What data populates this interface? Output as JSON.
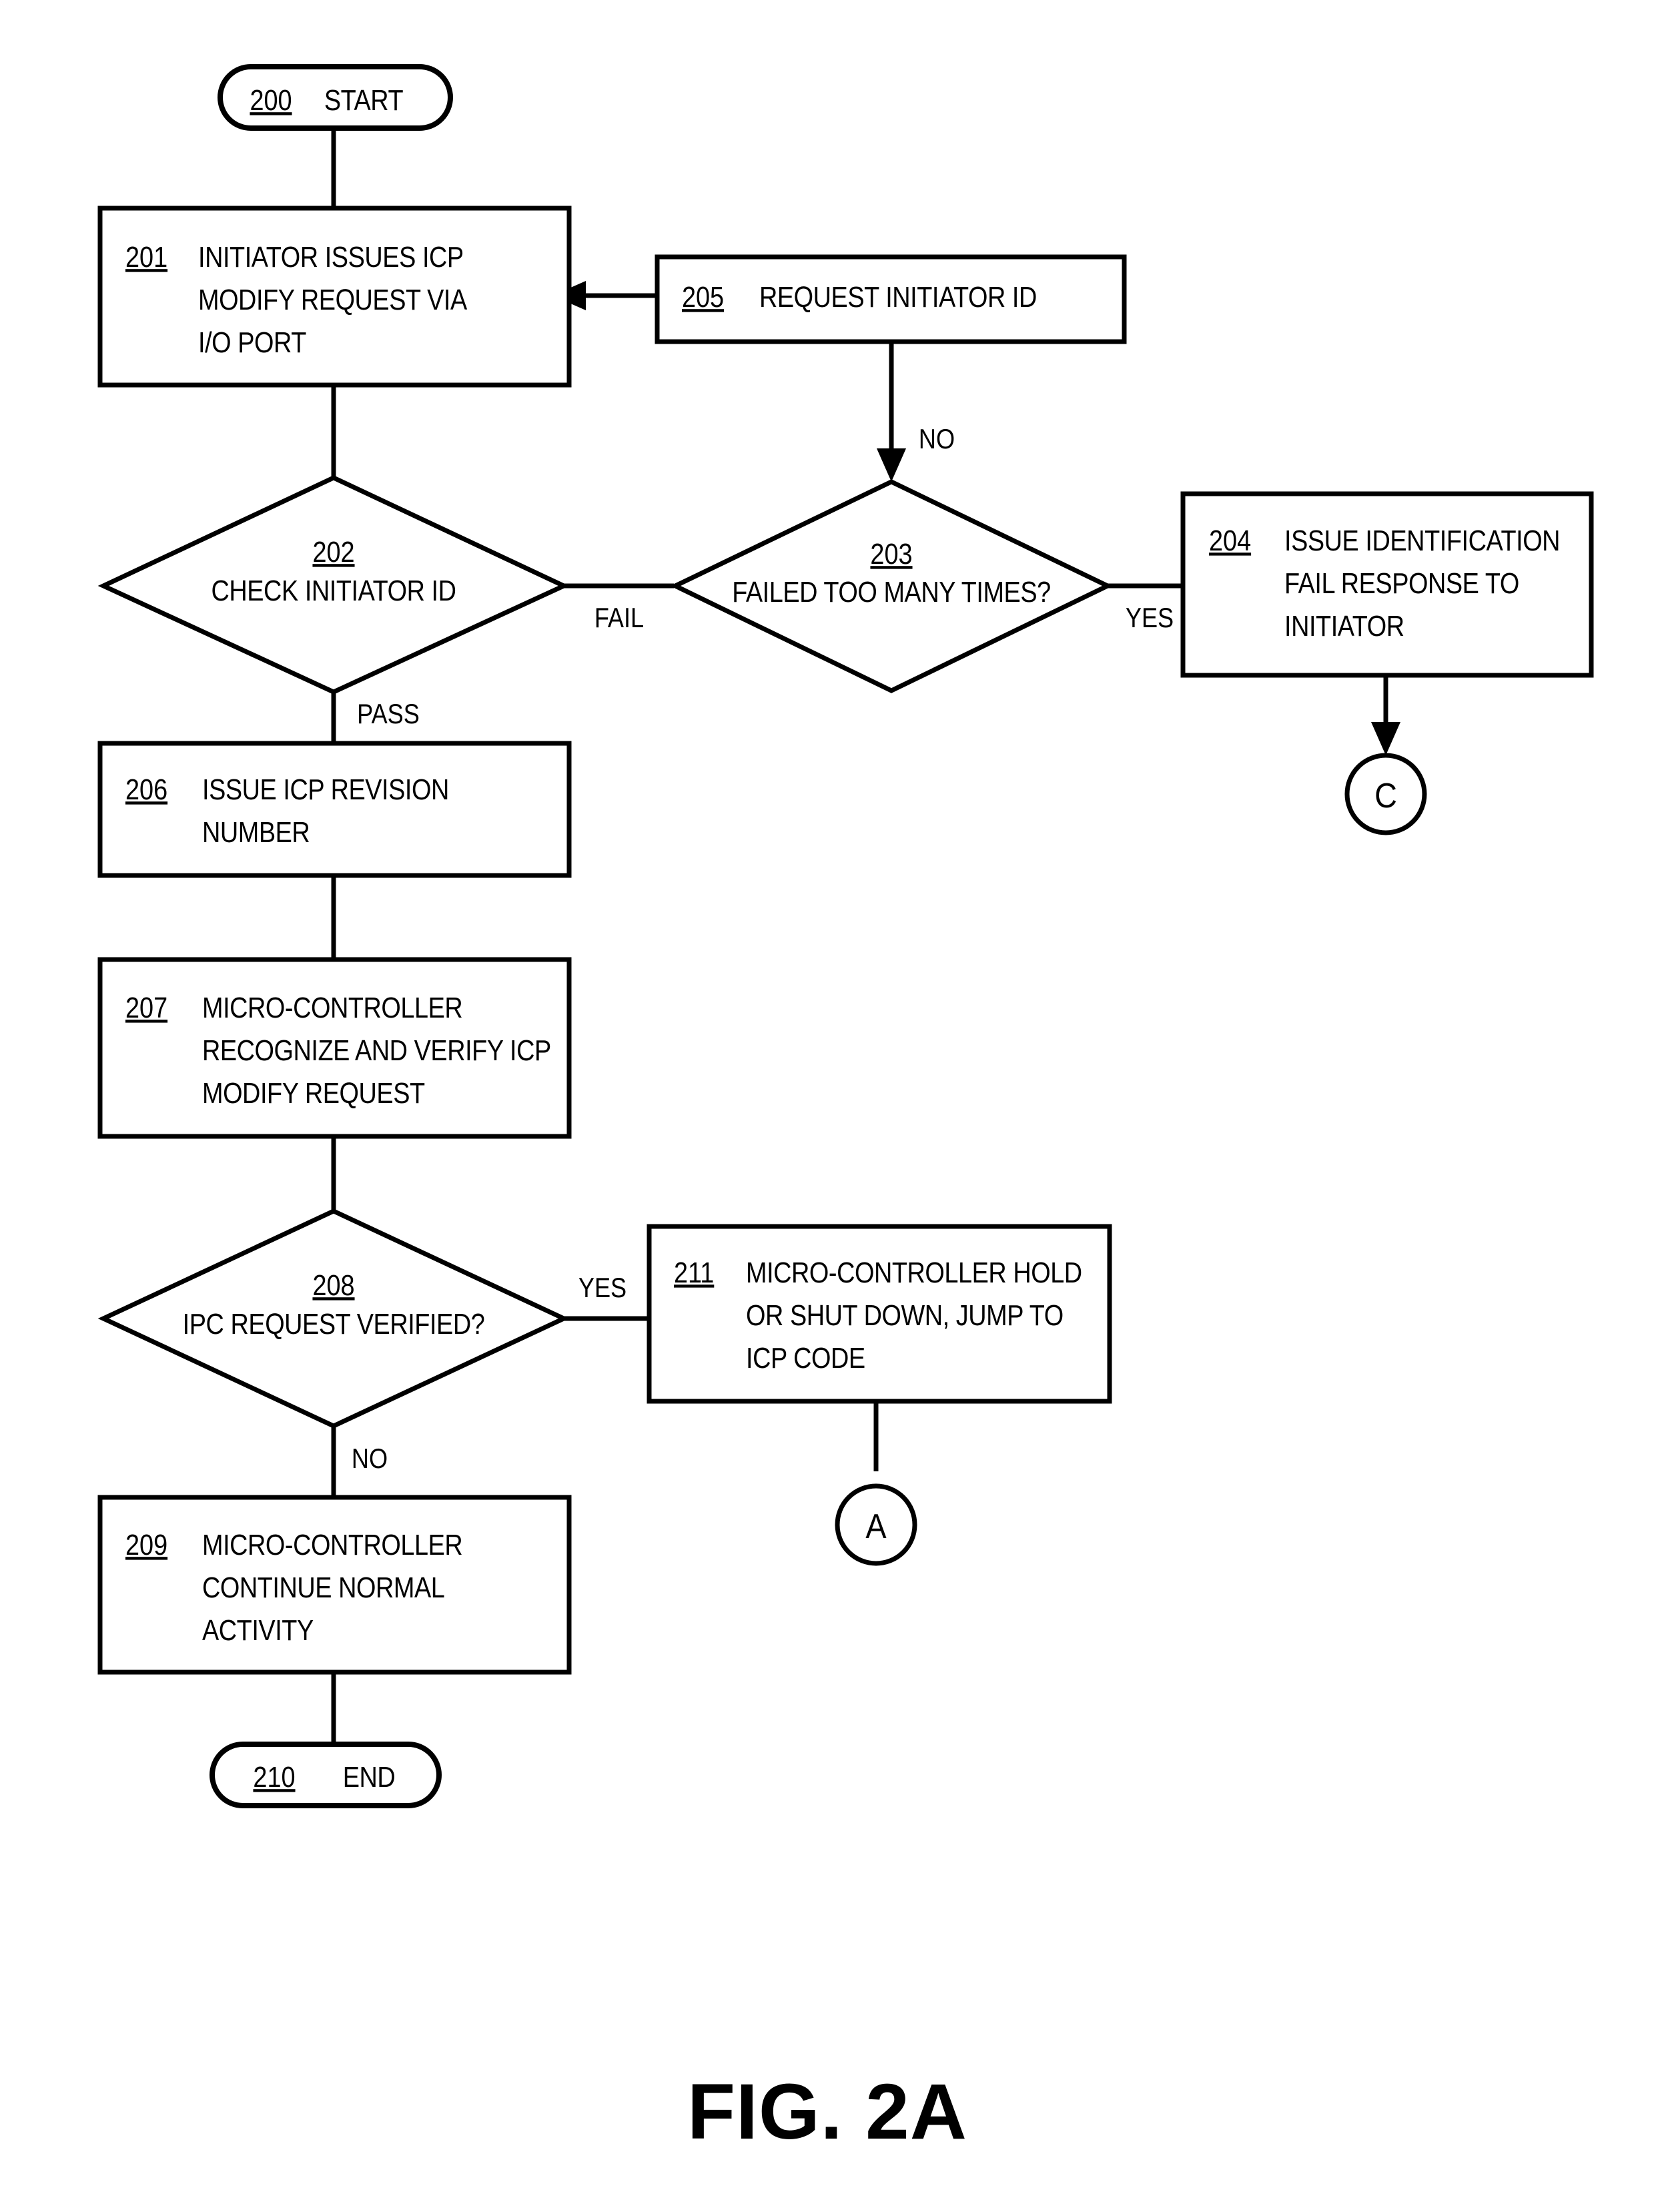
{
  "figure": {
    "caption": "FIG. 2A",
    "type": "flowchart"
  },
  "nodes": {
    "n200": {
      "ref": "200",
      "label": "START",
      "shape": "terminator"
    },
    "n201": {
      "ref": "201",
      "lines": [
        "INITIATOR ISSUES ICP",
        "MODIFY REQUEST VIA",
        "I/O PORT"
      ],
      "shape": "process"
    },
    "n202": {
      "ref": "202",
      "label": "CHECK INITIATOR ID",
      "shape": "decision"
    },
    "n203": {
      "ref": "203",
      "label": "FAILED TOO MANY TIMES?",
      "shape": "decision"
    },
    "n204": {
      "ref": "204",
      "lines": [
        "ISSUE IDENTIFICATION",
        "FAIL RESPONSE TO",
        "INITIATOR"
      ],
      "shape": "process"
    },
    "n205": {
      "ref": "205",
      "lines": [
        "REQUEST INITIATOR ID"
      ],
      "shape": "process"
    },
    "n206": {
      "ref": "206",
      "lines": [
        "ISSUE ICP REVISION",
        "NUMBER"
      ],
      "shape": "process"
    },
    "n207": {
      "ref": "207",
      "lines": [
        "MICRO-CONTROLLER",
        "RECOGNIZE AND VERIFY ICP",
        "MODIFY REQUEST"
      ],
      "shape": "process"
    },
    "n208": {
      "ref": "208",
      "label": "IPC REQUEST VERIFIED?",
      "shape": "decision"
    },
    "n209": {
      "ref": "209",
      "lines": [
        "MICRO-CONTROLLER",
        "CONTINUE NORMAL",
        "ACTIVITY"
      ],
      "shape": "process"
    },
    "n210": {
      "ref": "210",
      "label": "END",
      "shape": "terminator"
    },
    "n211": {
      "ref": "211",
      "lines": [
        "MICRO-CONTROLLER HOLD",
        "OR SHUT DOWN, JUMP TO",
        "ICP CODE"
      ],
      "shape": "process"
    },
    "connector_c": {
      "label": "C",
      "shape": "connector"
    },
    "connector_a": {
      "label": "A",
      "shape": "connector"
    }
  },
  "edge_labels": {
    "e202_fail": "FAIL",
    "e202_pass": "PASS",
    "e203_yes": "YES",
    "e205_no": "NO",
    "e208_yes": "YES",
    "e208_no": "NO"
  },
  "flow": [
    {
      "from": "200",
      "to": "201",
      "label": ""
    },
    {
      "from": "201",
      "to": "202",
      "label": ""
    },
    {
      "from": "202",
      "to": "203",
      "label": "FAIL"
    },
    {
      "from": "202",
      "to": "206",
      "label": "PASS"
    },
    {
      "from": "203",
      "to": "204",
      "label": "YES"
    },
    {
      "from": "205",
      "to": "203",
      "label": "NO"
    },
    {
      "from": "205",
      "to": "201",
      "label": ""
    },
    {
      "from": "204",
      "to": "C",
      "label": ""
    },
    {
      "from": "206",
      "to": "207",
      "label": ""
    },
    {
      "from": "207",
      "to": "208",
      "label": ""
    },
    {
      "from": "208",
      "to": "211",
      "label": "YES"
    },
    {
      "from": "208",
      "to": "209",
      "label": "NO"
    },
    {
      "from": "209",
      "to": "210",
      "label": ""
    },
    {
      "from": "211",
      "to": "A",
      "label": ""
    }
  ],
  "colors": {
    "ink": "#000000",
    "paper": "#ffffff"
  }
}
